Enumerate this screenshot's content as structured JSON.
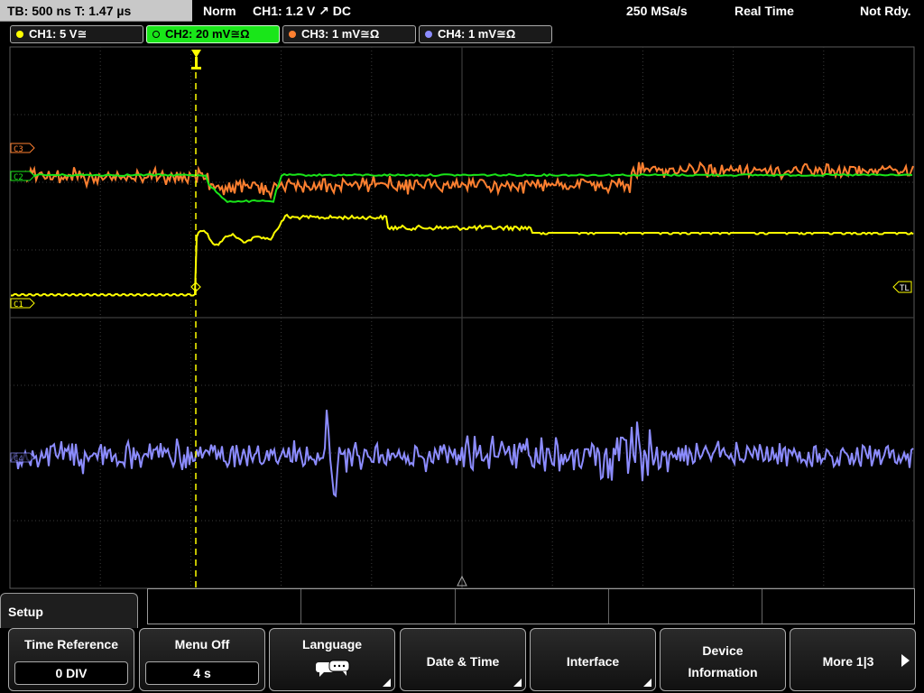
{
  "top_bar": {
    "timebase": "TB: 500 ns   T: 1.47 µs",
    "trigger_mode": "Norm",
    "trigger_source": "CH1: 1.2 V ↗ DC",
    "sample_rate": "250 MSa/s",
    "acquisition_mode": "Real Time",
    "status": "Not Rdy."
  },
  "channels": [
    {
      "label": "CH1: 5 V≅",
      "color": "#ffff00",
      "active": false
    },
    {
      "label": "CH2: 20 mV≅Ω",
      "color": "#19e619",
      "active": true
    },
    {
      "label": "CH3: 1 mV≅Ω",
      "color": "#ff8030",
      "active": false
    },
    {
      "label": "CH4: 1 mV≅Ω",
      "color": "#8c8cff",
      "active": false
    }
  ],
  "markers": {
    "ch3": "C3",
    "ch2": "C2",
    "ch1": "C1",
    "ch4": "C4",
    "trigger_level": "TL"
  },
  "menu": {
    "title": "Setup",
    "softkeys": [
      {
        "title": "Time Reference",
        "value": "0 DIV"
      },
      {
        "title": "Menu Off",
        "value": "4 s"
      },
      {
        "title": "Language",
        "icon": "speech-bubble-icon"
      },
      {
        "title": "Date & Time"
      },
      {
        "title": "Interface"
      },
      {
        "title": "Device",
        "title2": "Information"
      },
      {
        "title": "More 1|3",
        "icon": "arrow-right-icon"
      }
    ]
  },
  "colors": {
    "ch1": "#ffff00",
    "ch2": "#19e619",
    "ch3": "#ff8030",
    "ch4": "#8c8cff",
    "grid": "#3c3c3c",
    "trigger": "#ffff00"
  }
}
